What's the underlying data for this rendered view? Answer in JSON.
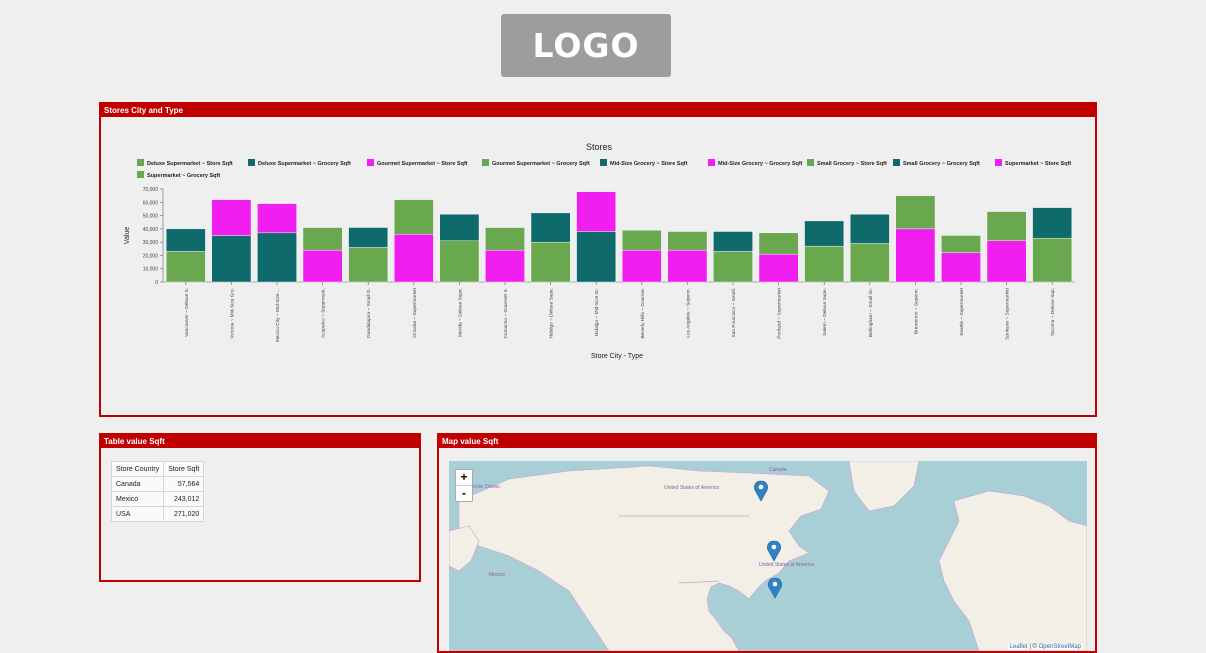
{
  "logo": {
    "text": "LOGO"
  },
  "chart_panel": {
    "title": "Stores City and Type"
  },
  "table_panel": {
    "title": "Table value Sqft"
  },
  "map_panel": {
    "title": "Map value Sqft"
  },
  "table": {
    "headers": [
      "Store Country",
      "Store Sqft"
    ],
    "rows": [
      {
        "country": "Canada",
        "sqft": "57,564"
      },
      {
        "country": "Mexico",
        "sqft": "243,012"
      },
      {
        "country": "USA",
        "sqft": "271,020"
      }
    ]
  },
  "map": {
    "zoom_in": "+",
    "zoom_out": "-",
    "labels": [
      "Arctic Ocean",
      "United States of America",
      "United States of America",
      "Canada",
      "Mexico"
    ],
    "attribution_leaflet": "Leaflet",
    "attribution_sep": " | © ",
    "attribution_osm": "OpenStreetMap"
  },
  "chart_data": {
    "type": "bar",
    "stacked": true,
    "title": "Stores",
    "xlabel": "Store City - Type",
    "ylabel": "Value",
    "ylim": [
      0,
      70000
    ],
    "yticks": [
      "0",
      "10,000",
      "20,000",
      "30,000",
      "40,000",
      "50,000",
      "60,000",
      "70,000"
    ],
    "legend_position": "top",
    "categories": [
      "Vancouver ~ Deluxe S.",
      "Victoria ~ Mid-Size Gro.",
      "Mexico City ~ Mid-Size ...",
      "Acapulco ~ Supermark.",
      "Guadalajara ~ Small G.",
      "Orizaba ~ Supermarket",
      "Merida ~ Deluxe Supe.",
      "Camacho ~ Gourmet S.",
      "Hidalgo ~ Deluxe Supe.",
      "Hidalgo ~ Mid-Size Gr.",
      "Beverly Hills ~ Gourme.",
      "Los Angeles ~ Superm.",
      "San Francisco ~ Small.",
      "Portland ~ Supermarket",
      "Salem ~ Deluxe Supe.",
      "Bellingham ~ Small Gr.",
      "Bremerton ~ Superm.",
      "Seattle ~ Supermarket",
      "Spokane ~ Supermarket",
      "Tacoma ~ Deluxe Sup."
    ],
    "series": [
      {
        "name": "Deluxe Supermarket ~ Store Sqft",
        "color": "#6aa84f",
        "values": [
          23000,
          0,
          0,
          0,
          0,
          0,
          31000,
          0,
          30000,
          0,
          0,
          0,
          0,
          0,
          27000,
          0,
          0,
          0,
          0,
          33000
        ]
      },
      {
        "name": "Deluxe Supermarket ~ Grocery Sqft",
        "color": "#0f6b6b",
        "values": [
          17000,
          0,
          0,
          0,
          0,
          0,
          20000,
          0,
          22000,
          0,
          0,
          0,
          0,
          0,
          19000,
          0,
          0,
          0,
          0,
          23000
        ]
      },
      {
        "name": "Gourmet Supermarket ~ Store Sqft",
        "color": "#f01ff0",
        "values": [
          0,
          0,
          0,
          0,
          0,
          0,
          0,
          24000,
          0,
          0,
          24000,
          0,
          0,
          0,
          0,
          0,
          0,
          0,
          0,
          0
        ]
      },
      {
        "name": "Gourmet Supermarket ~ Grocery Sqft",
        "color": "#6aa84f",
        "values": [
          0,
          0,
          0,
          0,
          0,
          0,
          0,
          17000,
          0,
          0,
          15000,
          0,
          0,
          0,
          0,
          0,
          0,
          0,
          0,
          0
        ]
      },
      {
        "name": "Mid-Size Grocery ~ Store Sqft",
        "color": "#0f6b6b",
        "values": [
          0,
          35000,
          37000,
          0,
          0,
          0,
          0,
          0,
          0,
          38000,
          0,
          0,
          0,
          0,
          0,
          0,
          0,
          0,
          0,
          0
        ]
      },
      {
        "name": "Mid-Size Grocery ~ Grocery Sqft",
        "color": "#f01ff0",
        "values": [
          0,
          27000,
          22000,
          0,
          0,
          0,
          0,
          0,
          0,
          30000,
          0,
          0,
          0,
          0,
          0,
          0,
          0,
          0,
          0,
          0
        ]
      },
      {
        "name": "Small Grocery ~ Store Sqft",
        "color": "#6aa84f",
        "values": [
          0,
          0,
          0,
          0,
          26000,
          0,
          0,
          0,
          0,
          0,
          0,
          0,
          23000,
          0,
          0,
          29000,
          0,
          0,
          0,
          0
        ]
      },
      {
        "name": "Small Grocery ~ Grocery Sqft",
        "color": "#0f6b6b",
        "values": [
          0,
          0,
          0,
          0,
          15000,
          0,
          0,
          0,
          0,
          0,
          0,
          0,
          15000,
          0,
          0,
          22000,
          0,
          0,
          0,
          0
        ]
      },
      {
        "name": "Supermarket ~ Store Sqft",
        "color": "#f01ff0",
        "values": [
          0,
          0,
          0,
          24000,
          0,
          36000,
          0,
          0,
          0,
          0,
          0,
          24000,
          0,
          21000,
          0,
          0,
          40000,
          22000,
          31000,
          0
        ]
      },
      {
        "name": "Supermarket ~ Grocery Sqft",
        "color": "#6aa84f",
        "values": [
          0,
          0,
          0,
          17000,
          0,
          26000,
          0,
          0,
          0,
          0,
          0,
          14000,
          0,
          16000,
          0,
          0,
          25000,
          13000,
          22000,
          0
        ]
      }
    ]
  }
}
